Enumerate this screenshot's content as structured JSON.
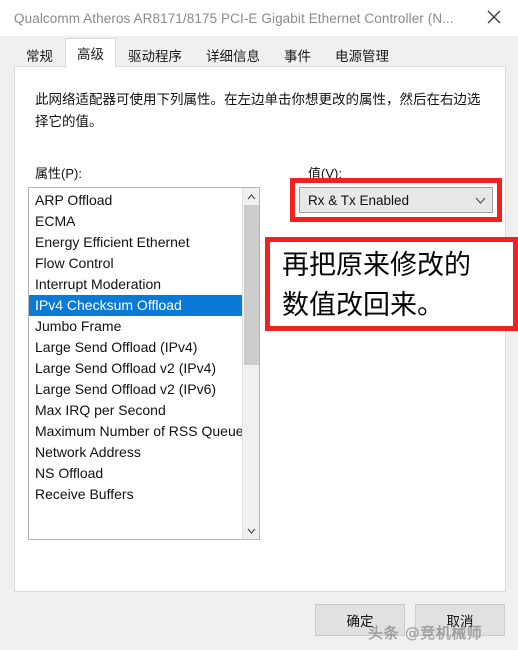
{
  "window": {
    "title": "Qualcomm Atheros AR8171/8175 PCI-E Gigabit Ethernet Controller (N...",
    "close_icon": "close-icon"
  },
  "tabs": [
    {
      "label": "常规",
      "selected": false
    },
    {
      "label": "高级",
      "selected": true
    },
    {
      "label": "驱动程序",
      "selected": false
    },
    {
      "label": "详细信息",
      "selected": false
    },
    {
      "label": "事件",
      "selected": false
    },
    {
      "label": "电源管理",
      "selected": false
    }
  ],
  "panel": {
    "description": "此网络适配器可使用下列属性。在左边单击你想更改的属性，然后在右边选择它的值。",
    "property_label": "属性(P):",
    "value_label": "值(V):"
  },
  "property_list": {
    "items": [
      "ARP Offload",
      "ECMA",
      "Energy Efficient Ethernet",
      "Flow Control",
      "Interrupt Moderation",
      "IPv4 Checksum Offload",
      "Jumbo Frame",
      "Large Send Offload (IPv4)",
      "Large Send Offload v2 (IPv4)",
      "Large Send Offload v2 (IPv6)",
      "Max IRQ per Second",
      "Maximum Number of RSS Queue",
      "Network Address",
      "NS Offload",
      "Receive Buffers"
    ],
    "selected_index": 5,
    "scroll_up_icon": "chevron-up-icon",
    "scroll_down_icon": "chevron-down-icon"
  },
  "value_combo": {
    "selected": "Rx & Tx Enabled",
    "arrow_icon": "chevron-down-icon",
    "highlight_color": "#f42121"
  },
  "annotation": {
    "text": "再把原来修改的\n数值改回来。",
    "border_color": "#f42121"
  },
  "footer": {
    "ok_label": "确定",
    "cancel_label": "取消"
  },
  "watermark": {
    "text": "头条 @竞机械师"
  },
  "colors": {
    "selection_blue": "#0b7ad6",
    "dialog_bg": "#f0f0f0",
    "panel_bg": "#ffffff"
  }
}
